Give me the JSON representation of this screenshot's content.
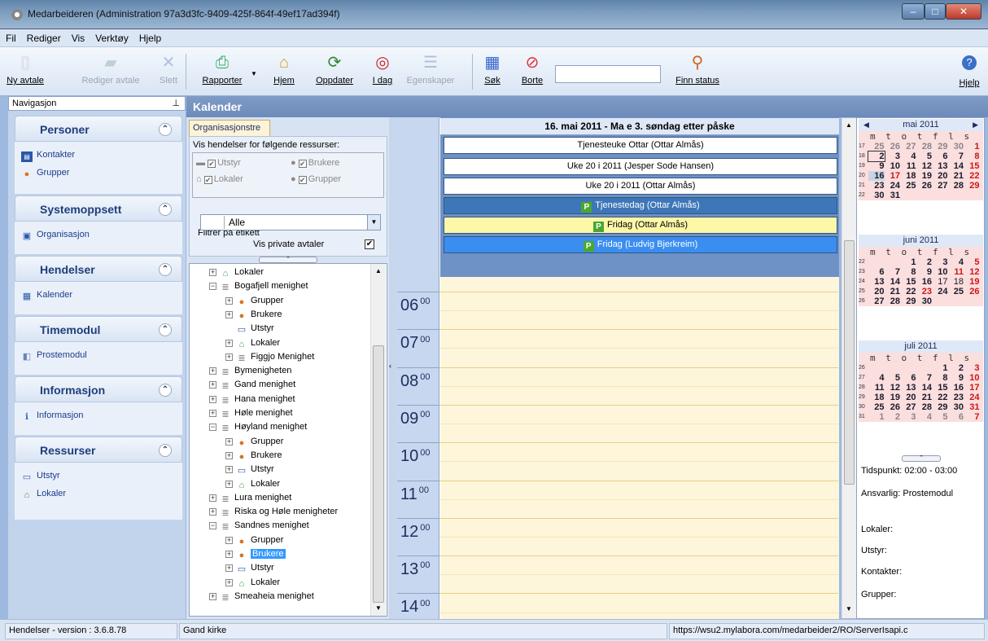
{
  "window": {
    "title": "Medarbeideren (Administration 97a3d3fc-9409-425f-864f-49ef17ad394f)"
  },
  "menu": [
    "Fil",
    "Rediger",
    "Vis",
    "Verktøy",
    "Hjelp"
  ],
  "toolbar": {
    "ny_avtale": "Ny avtale",
    "rediger_avtale": "Rediger avtale",
    "slett": "Slett",
    "rapporter": "Rapporter",
    "hjem": "Hjem",
    "oppdater": "Oppdater",
    "idag": "I dag",
    "egenskaper": "Egenskaper",
    "sok": "Søk",
    "borte": "Borte",
    "finn_status": "Finn status",
    "hjelp": "Hjelp"
  },
  "nav": {
    "header": "Navigasjon",
    "groups": [
      {
        "title": "Personer",
        "items": [
          "Kontakter",
          "Grupper"
        ]
      },
      {
        "title": "Systemoppsett",
        "items": [
          "Organisasjon"
        ]
      },
      {
        "title": "Hendelser",
        "items": [
          "Kalender"
        ]
      },
      {
        "title": "Timemodul",
        "items": [
          "Prostemodul"
        ]
      },
      {
        "title": "Informasjon",
        "items": [
          "Informasjon"
        ]
      },
      {
        "title": "Ressurser",
        "items": [
          "Utstyr",
          "Lokaler"
        ]
      }
    ]
  },
  "calendar_header": "Kalender",
  "org": {
    "tab": "Organisasjonstre",
    "resources_label": "Vis hendelser for følgende ressurser:",
    "res": [
      "Utstyr",
      "Brukere",
      "Lokaler",
      "Grupper"
    ],
    "filter_label": "Filtrer på etikett",
    "filter_value": "Alle",
    "private_label": "Vis private avtaler",
    "tree": [
      "Lokaler",
      "Bogafjell menighet",
      "Grupper",
      "Brukere",
      "Utstyr",
      "Lokaler",
      "Figgjo Menighet",
      "Bymenigheten",
      "Gand menighet",
      "Hana menighet",
      "Høle menighet",
      "Høyland menighet",
      "Grupper",
      "Brukere",
      "Utstyr",
      "Lokaler",
      "Lura menighet",
      "Riska og Høle menigheter",
      "Sandnes menighet",
      "Grupper",
      "Brukere",
      "Utstyr",
      "Lokaler",
      "Smeaheia menighet"
    ]
  },
  "day": {
    "header": "16. mai 2011 - Ma e 3. søndag etter påske",
    "events": [
      {
        "text": "Tjenesteuke Ottar (Ottar  Almås)",
        "color": "#ffffff"
      },
      {
        "text": "Uke 20 i 2011 (Jesper Sode Hansen)",
        "color": "#ffffff"
      },
      {
        "text": "Uke 20 i 2011 (Ottar  Almås)",
        "color": "#ffffff"
      },
      {
        "text": "Tjenestedag (Ottar Almås)",
        "color": "#3e77b8"
      },
      {
        "text": "Fridag (Ottar Almås)",
        "color": "#fdf7a8"
      },
      {
        "text": "Fridag (Ludvig Bjerkreim)",
        "color": "#3a8ef0"
      }
    ],
    "hours": [
      "06",
      "07",
      "08",
      "09",
      "10",
      "11",
      "12",
      "13",
      "14"
    ],
    "hour_minutes": "00"
  },
  "mini_calendars": [
    {
      "title": "mai 2011",
      "weekdays": "m t o t f l s"
    },
    {
      "title": "juni 2011",
      "weekdays": "m t o t f l s"
    },
    {
      "title": "juli 2011",
      "weekdays": "m t o t f l s"
    }
  ],
  "details": {
    "tidspunkt": "Tidspunkt: 02:00 - 03:00",
    "ansvarlig": "Ansvarlig: Prostemodul",
    "lokaler": "Lokaler:",
    "utstyr": "Utstyr:",
    "kontakter": "Kontakter:",
    "grupper": "Grupper:"
  },
  "status": {
    "version": "Hendelser - version : 3.6.8.78",
    "location": "Gand kirke",
    "url": "https://wsu2.mylabora.com/medarbeider2/RO/ServerIsapi.c"
  }
}
